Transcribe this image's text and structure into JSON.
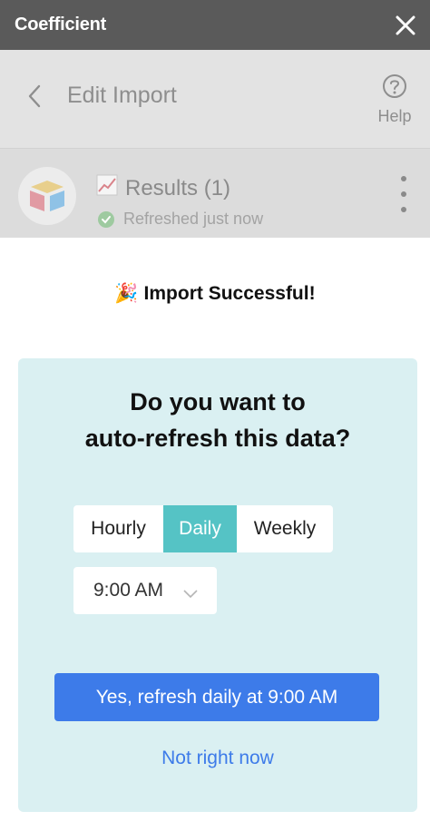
{
  "window": {
    "title": "Coefficient",
    "close_icon": "close-icon"
  },
  "header": {
    "title": "Edit Import",
    "back_icon": "chevron-left-icon",
    "help_label": "Help",
    "help_icon": "question-circle-icon"
  },
  "import_item": {
    "icon": "chart-increasing-icon",
    "title": "Results (1)",
    "status": "Refreshed just now",
    "status_icon": "check-circle-icon",
    "logo": "airtable-logo",
    "menu_icon": "kebab-menu-icon"
  },
  "success": {
    "emoji": "🎉",
    "message": "Import Successful!"
  },
  "refresh_prompt": {
    "question_line1": "Do you want to",
    "question_line2": "auto-refresh this data?",
    "frequency_options": [
      "Hourly",
      "Daily",
      "Weekly"
    ],
    "selected_frequency": "Daily",
    "time_value": "9:00 AM",
    "confirm_label": "Yes, refresh daily at 9:00 AM",
    "dismiss_label": "Not right now"
  },
  "colors": {
    "titlebar": "#5a5a5a",
    "selected_option": "#55c3c5",
    "primary_button": "#3d7be9",
    "card_background": "#daf0f2"
  }
}
